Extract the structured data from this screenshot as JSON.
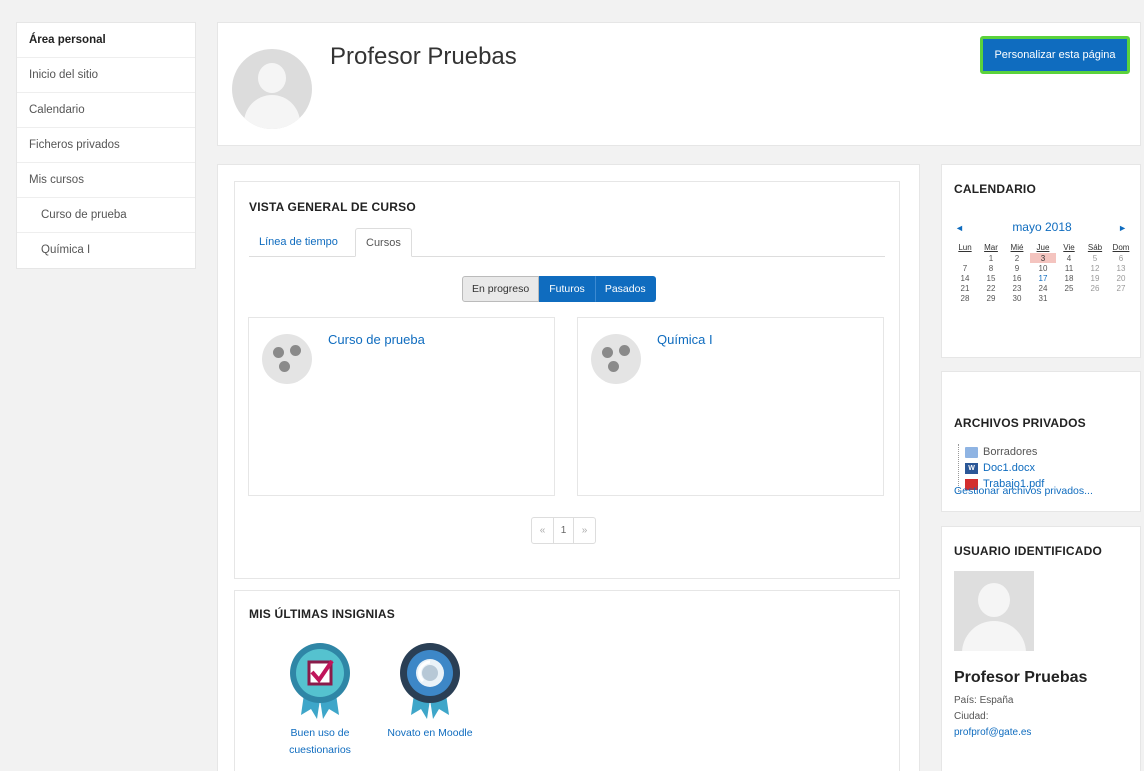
{
  "nav": {
    "items": [
      {
        "label": "Área personal"
      },
      {
        "label": "Inicio del sitio"
      },
      {
        "label": "Calendario"
      },
      {
        "label": "Ficheros privados"
      },
      {
        "label": "Mis cursos"
      },
      {
        "label": "Curso de prueba"
      },
      {
        "label": "Química I"
      }
    ]
  },
  "header": {
    "title": "Profesor Pruebas",
    "customize_label": "Personalizar esta página"
  },
  "overview": {
    "title": "VISTA GENERAL DE CURSO",
    "tabs": [
      {
        "label": "Línea de tiempo"
      },
      {
        "label": "Cursos"
      }
    ],
    "active_tab": "Cursos",
    "filters": [
      {
        "label": "En progreso"
      },
      {
        "label": "Futuros"
      },
      {
        "label": "Pasados"
      }
    ],
    "courses": [
      {
        "name": "Curso de prueba"
      },
      {
        "name": "Química I"
      }
    ],
    "pagination": {
      "prev": "«",
      "current": "1",
      "next": "»"
    }
  },
  "badges": {
    "title": "MIS ÚLTIMAS INSIGNIAS",
    "items": [
      {
        "label_line1": "Buen uso de",
        "label_line2": "cuestionarios"
      },
      {
        "label_line1": "Novato en Moodle",
        "label_line2": ""
      }
    ]
  },
  "calendar": {
    "title": "CALENDARIO",
    "prev": "◄",
    "next": "►",
    "month": "mayo 2018",
    "weekdays": [
      "Lun",
      "Mar",
      "Mié",
      "Jue",
      "Vie",
      "Sáb",
      "Dom"
    ],
    "today": "3"
  },
  "private_files": {
    "title": "ARCHIVOS PRIVADOS",
    "files": [
      {
        "name": "Borradores",
        "icon": "folder-icon"
      },
      {
        "name": "Doc1.docx",
        "icon": "word-icon"
      },
      {
        "name": "Trabajo1.pdf",
        "icon": "pdf-icon"
      }
    ],
    "manage_label": "Gestionar archivos privados..."
  },
  "logged_user": {
    "title": "USUARIO IDENTIFICADO",
    "name": "Profesor Pruebas",
    "country": "País: España",
    "city": "Ciudad:",
    "email": "profprof@gate.es"
  },
  "colors": {
    "brand": "#0f6cbf",
    "highlight_border": "#5bd23c",
    "today": "#f4c4bf"
  }
}
